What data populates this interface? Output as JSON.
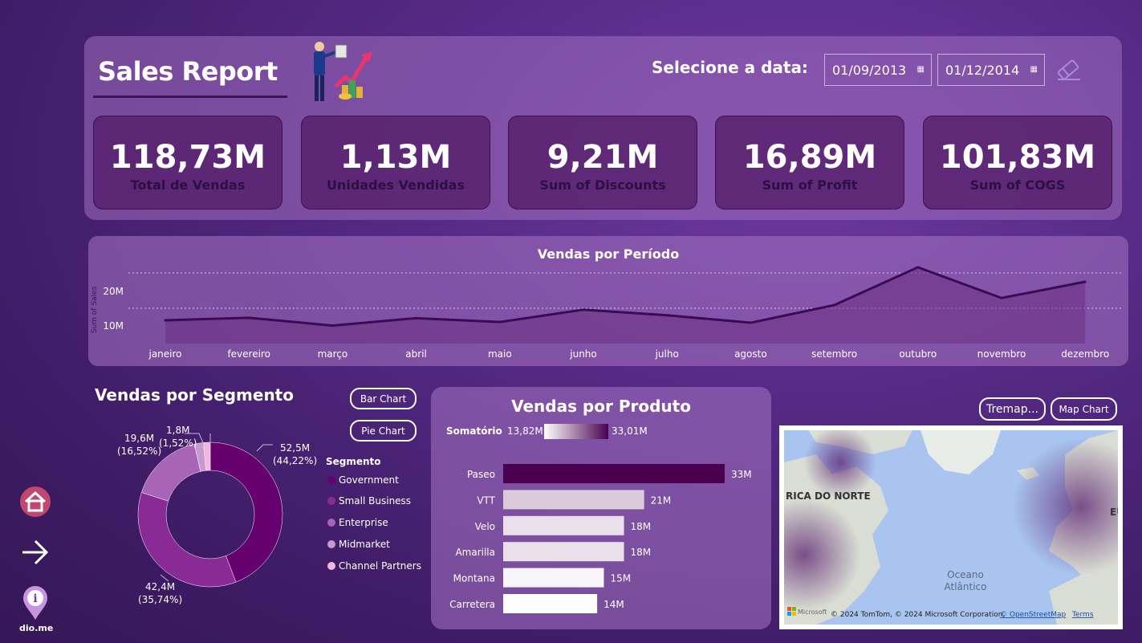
{
  "header": {
    "title": "Sales Report",
    "date_label": "Selecione a data:",
    "date_start": "01/09/2013",
    "date_end": "01/12/2014"
  },
  "kpis": [
    {
      "value": "118,73M",
      "label": "Total de Vendas"
    },
    {
      "value": "1,13M",
      "label": "Unidades Vendidas"
    },
    {
      "value": "9,21M",
      "label": "Sum of Discounts"
    },
    {
      "value": "16,89M",
      "label": "Sum of Profit"
    },
    {
      "value": "101,83M",
      "label": "Sum of COGS"
    }
  ],
  "period_chart": {
    "title": "Vendas por Período",
    "ylabel": "Sum of Sales",
    "tick_20": "20M",
    "tick_10": "10M",
    "months": [
      "janeiro",
      "fevereiro",
      "março",
      "abril",
      "maio",
      "junho",
      "julho",
      "agosto",
      "setembro",
      "outubro",
      "novembro",
      "dezembro"
    ]
  },
  "segment": {
    "title": "Vendas por Segmento",
    "bar_chart_button": "Bar Chart",
    "pie_chart_button": "Pie Chart",
    "legend_title": "Segmento",
    "legend": [
      "Government",
      "Small Business",
      "Enterprise",
      "Midmarket",
      "Channel Partners"
    ],
    "label_gov_v": "52,5M",
    "label_gov_p": "(44,22%)",
    "label_sb_v": "42,4M",
    "label_sb_p": "(35,74%)",
    "label_ent_v": "19,6M",
    "label_ent_p": "(16,52%)",
    "label_cp_v": "1,8M",
    "label_cp_p": "(1,52%)"
  },
  "product": {
    "title": "Vendas por Produto",
    "scale_label": "Somatório",
    "scale_min": "13,82M",
    "scale_max": "33,01M"
  },
  "map": {
    "treemap_button": "Tremap...",
    "map_chart_button": "Map Chart",
    "label_na": "RICA DO NORTE",
    "label_ocean_1": "Oceano",
    "label_ocean_2": "Atlântico",
    "label_eu": "EU",
    "attribution": "© 2024 TomTom, © 2024 Microsoft Corporation,",
    "osm_link": "© OpenStreetMap",
    "terms_link": "Terms",
    "ms_logo": "Microsoft"
  },
  "nav": {
    "dio_label": "dio.me"
  },
  "chart_data": [
    {
      "type": "area",
      "title": "Vendas por Período",
      "ylabel": "Sum of Sales",
      "x": [
        "janeiro",
        "fevereiro",
        "março",
        "abril",
        "maio",
        "junho",
        "julho",
        "agosto",
        "setembro",
        "outubro",
        "novembro",
        "dezembro"
      ],
      "series": [
        {
          "values": [
            6.6,
            7.3,
            5.1,
            7.2,
            6.1,
            9.6,
            8.0,
            5.9,
            10.9,
            21.6,
            12.9,
            17.5
          ]
        }
      ],
      "y_ticks": [
        10,
        20
      ],
      "ylim": [
        0,
        25
      ],
      "grid": true
    },
    {
      "type": "pie",
      "title": "Vendas por Segmento",
      "donut": true,
      "categories": [
        "Government",
        "Small Business",
        "Enterprise",
        "Midmarket",
        "Channel Partners"
      ],
      "values": [
        52.5,
        42.4,
        19.6,
        2.4,
        1.8
      ],
      "colors": [
        "#66006e",
        "#8a2a96",
        "#a865b8",
        "#c79ad0",
        "#f2b6e0"
      ]
    },
    {
      "type": "bar",
      "title": "Vendas por Produto",
      "orientation": "horizontal",
      "categories": [
        "Paseo",
        "VTT",
        "Velo",
        "Amarilla",
        "Montana",
        "Carretera"
      ],
      "values": [
        33,
        21,
        18,
        18,
        15,
        14
      ],
      "value_labels": [
        "33M",
        "21M",
        "18M",
        "18M",
        "15M",
        "14M"
      ],
      "color_scale": {
        "min": 13.82,
        "max": 33.01,
        "min_color": "#ffffff",
        "max_color": "#4a004f"
      }
    }
  ]
}
